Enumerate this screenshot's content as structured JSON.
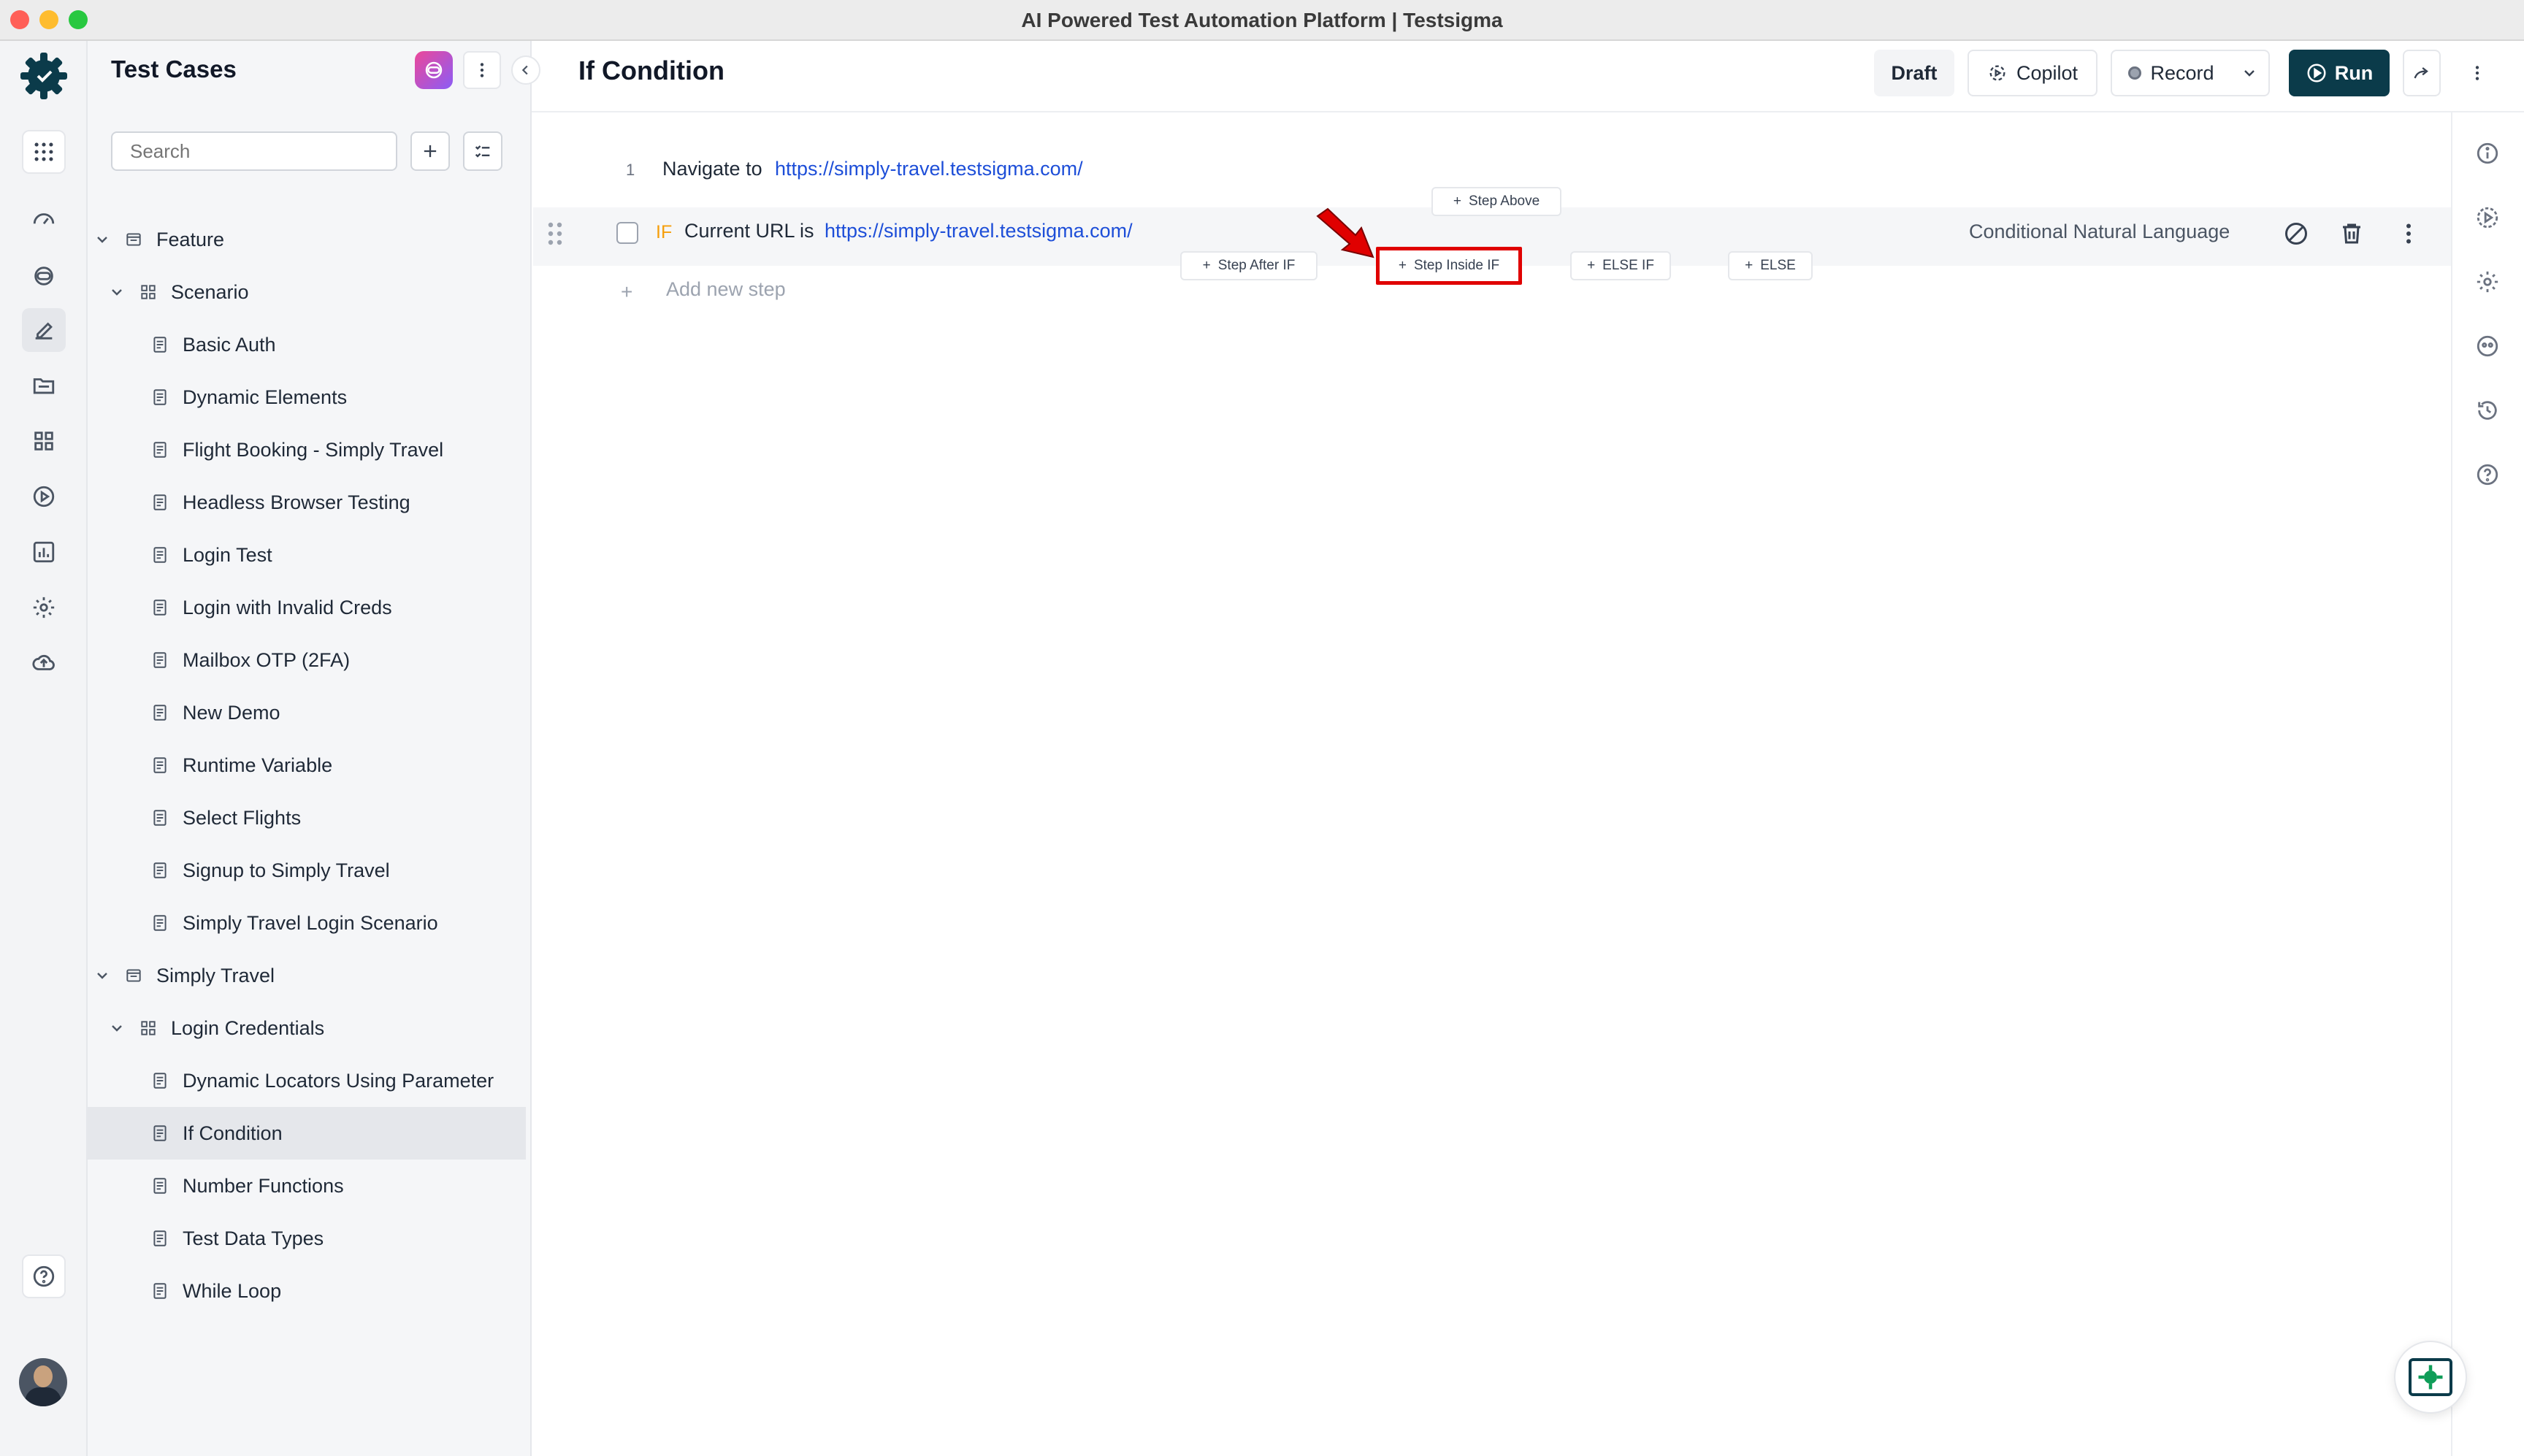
{
  "window": {
    "title": "AI Powered Test Automation Platform | Testsigma"
  },
  "sidebar": {
    "title": "Test Cases",
    "search_placeholder": "Search",
    "tree": [
      {
        "label": "Feature",
        "kind": "feature",
        "level": 0
      },
      {
        "label": "Scenario",
        "kind": "scenario",
        "level": 1
      },
      {
        "label": "Basic Auth",
        "kind": "case",
        "level": 2
      },
      {
        "label": "Dynamic Elements",
        "kind": "case",
        "level": 2
      },
      {
        "label": "Flight Booking - Simply Travel",
        "kind": "case",
        "level": 2
      },
      {
        "label": "Headless Browser Testing",
        "kind": "case",
        "level": 2
      },
      {
        "label": "Login Test",
        "kind": "case",
        "level": 2
      },
      {
        "label": "Login with Invalid Creds",
        "kind": "case",
        "level": 2
      },
      {
        "label": "Mailbox OTP (2FA)",
        "kind": "case",
        "level": 2
      },
      {
        "label": "New Demo",
        "kind": "case",
        "level": 2
      },
      {
        "label": "Runtime Variable",
        "kind": "case",
        "level": 2
      },
      {
        "label": "Select Flights",
        "kind": "case",
        "level": 2
      },
      {
        "label": "Signup to Simply Travel",
        "kind": "case",
        "level": 2
      },
      {
        "label": "Simply Travel Login Scenario",
        "kind": "case",
        "level": 2
      },
      {
        "label": "Simply Travel",
        "kind": "feature",
        "level": 0
      },
      {
        "label": "Login Credentials",
        "kind": "scenario",
        "level": 1
      },
      {
        "label": "Dynamic Locators Using Parameter",
        "kind": "case",
        "level": 2
      },
      {
        "label": "If Condition",
        "kind": "case",
        "level": 2,
        "selected": true
      },
      {
        "label": "Number Functions",
        "kind": "case",
        "level": 2
      },
      {
        "label": "Test Data Types",
        "kind": "case",
        "level": 2
      },
      {
        "label": "While Loop",
        "kind": "case",
        "level": 2
      }
    ]
  },
  "header": {
    "title": "If Condition",
    "draft_label": "Draft",
    "copilot_label": "Copilot",
    "record_label": "Record",
    "run_label": "Run"
  },
  "steps": {
    "step1": {
      "number": "1",
      "action": "Navigate to",
      "url": "https://simply-travel.testsigma.com/"
    },
    "step2": {
      "keyword": "IF",
      "condition": "Current URL is",
      "url": "https://simply-travel.testsigma.com/",
      "type_label": "Conditional Natural Language"
    },
    "add_step_label": "Add new step",
    "options": {
      "step_above": "Step Above",
      "step_after_if": "Step After IF",
      "step_inside_if": "Step Inside IF",
      "else_if": "ELSE IF",
      "else": "ELSE"
    }
  },
  "colors": {
    "brand": "#0b3b4a",
    "link": "#1d4ed8",
    "if_keyword": "#f59e0b",
    "highlight": "#e00000"
  }
}
